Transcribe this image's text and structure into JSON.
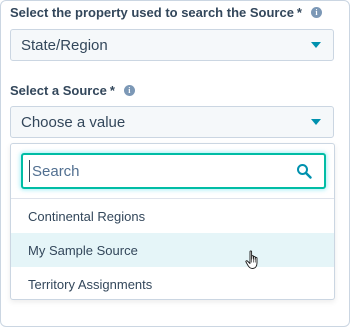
{
  "property_field": {
    "label": "Select the property used to search the Source",
    "required_marker": "*",
    "info_icon": "info-icon",
    "selected_value": "State/Region"
  },
  "source_field": {
    "label": "Select a Source",
    "required_marker": "*",
    "info_icon": "info-icon",
    "selected_value": "Choose a value"
  },
  "dropdown": {
    "search_placeholder": "Search",
    "search_icon": "search-icon",
    "options": [
      {
        "label": "Continental Regions"
      },
      {
        "label": "My Sample Source"
      },
      {
        "label": "Territory Assignments"
      }
    ],
    "hovered_option": "My Sample Source"
  },
  "colors": {
    "text": "#33475b",
    "accent": "#0091ae",
    "focus_border": "#00bda5",
    "hover_bg": "#e5f5f8",
    "field_bg": "#f5f8fa",
    "border": "#cbd6e2"
  },
  "cursor": "pointer-hand-icon"
}
